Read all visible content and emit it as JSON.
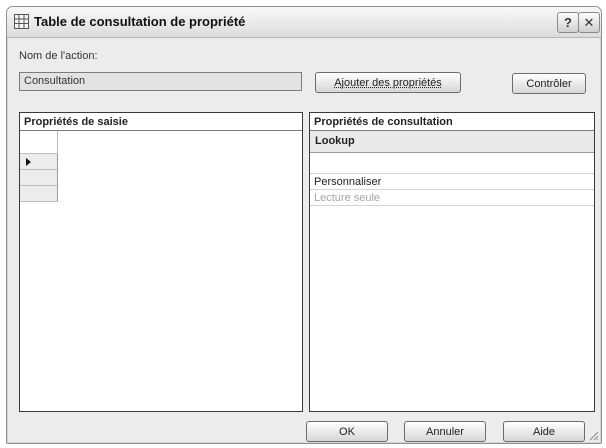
{
  "dialog": {
    "title": "Table de consultation de propriété",
    "help_label": "?",
    "close_label": "✕",
    "app_icon": "table-grid-icon"
  },
  "action_name": {
    "label": "Nom de l'action:",
    "value": "Consultation"
  },
  "buttons": {
    "add_properties": "Ajouter des propriétés",
    "check": "Contrôler",
    "ok": "OK",
    "cancel": "Annuler",
    "help": "Aide"
  },
  "input_panel": {
    "header": "Propriétés de saisie"
  },
  "lookup_panel": {
    "header": "Propriétés de consultation",
    "column_header": "Lookup",
    "rows": [
      "",
      "Personnaliser",
      "Lecture seule"
    ]
  }
}
